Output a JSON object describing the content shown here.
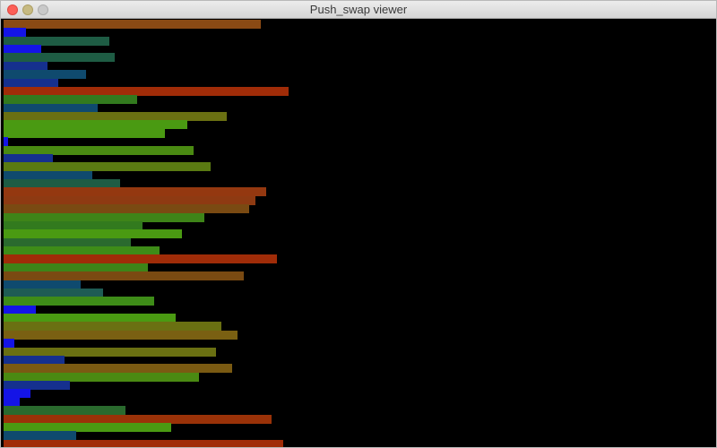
{
  "window": {
    "title": "Push_swap viewer"
  },
  "colors": {
    "background": "#000000",
    "blue": "#1414e6",
    "navy": "#15308e",
    "teal": "#0f4a6e",
    "dark-green": "#1e5c44",
    "green": "#327a1e",
    "lime": "#4a9a12",
    "olive": "#6a7012",
    "brown": "#7a4a12",
    "rust": "#8e3a12",
    "red": "#a02c08"
  },
  "stack": {
    "max_value": 330,
    "items": [
      {
        "value": 292,
        "color": "#8a4a14"
      },
      {
        "value": 25,
        "color": "#1414e6"
      },
      {
        "value": 120,
        "color": "#1e5c44"
      },
      {
        "value": 43,
        "color": "#1414e6"
      },
      {
        "value": 126,
        "color": "#1e5c44"
      },
      {
        "value": 50,
        "color": "#15308e"
      },
      {
        "value": 94,
        "color": "#0f4a6e"
      },
      {
        "value": 62,
        "color": "#15308e"
      },
      {
        "value": 324,
        "color": "#a02c08"
      },
      {
        "value": 152,
        "color": "#327a1e"
      },
      {
        "value": 107,
        "color": "#0f4a6e"
      },
      {
        "value": 254,
        "color": "#6a7012"
      },
      {
        "value": 209,
        "color": "#4a9a12"
      },
      {
        "value": 183,
        "color": "#4a9a12"
      },
      {
        "value": 5,
        "color": "#1414e6"
      },
      {
        "value": 216,
        "color": "#4a8a12"
      },
      {
        "value": 56,
        "color": "#15308e"
      },
      {
        "value": 235,
        "color": "#5a7a12"
      },
      {
        "value": 101,
        "color": "#0f4a6e"
      },
      {
        "value": 132,
        "color": "#1e5c44"
      },
      {
        "value": 298,
        "color": "#943810"
      },
      {
        "value": 286,
        "color": "#8e3a12"
      },
      {
        "value": 279,
        "color": "#7a4a12"
      },
      {
        "value": 228,
        "color": "#3e8418"
      },
      {
        "value": 158,
        "color": "#327a1e"
      },
      {
        "value": 203,
        "color": "#4a9a12"
      },
      {
        "value": 145,
        "color": "#2a6a2e"
      },
      {
        "value": 177,
        "color": "#3e8c18"
      },
      {
        "value": 311,
        "color": "#a02c08"
      },
      {
        "value": 164,
        "color": "#3e8418"
      },
      {
        "value": 273,
        "color": "#7a4a12"
      },
      {
        "value": 88,
        "color": "#0f4a6e"
      },
      {
        "value": 113,
        "color": "#1e5c54"
      },
      {
        "value": 171,
        "color": "#3e8c18"
      },
      {
        "value": 37,
        "color": "#1414e6"
      },
      {
        "value": 196,
        "color": "#4a9a12"
      },
      {
        "value": 247,
        "color": "#6a7012"
      },
      {
        "value": 266,
        "color": "#7a6012"
      },
      {
        "value": 12,
        "color": "#1414e6"
      },
      {
        "value": 241,
        "color": "#6a7012"
      },
      {
        "value": 69,
        "color": "#15308e"
      },
      {
        "value": 260,
        "color": "#7a5a12"
      },
      {
        "value": 222,
        "color": "#4a8a12"
      },
      {
        "value": 75,
        "color": "#15308e"
      },
      {
        "value": 31,
        "color": "#1414e6"
      },
      {
        "value": 18,
        "color": "#1414e6"
      },
      {
        "value": 139,
        "color": "#2a6a2e"
      },
      {
        "value": 305,
        "color": "#9a3208"
      },
      {
        "value": 190,
        "color": "#4a9a12"
      },
      {
        "value": 82,
        "color": "#0f4a6e"
      },
      {
        "value": 318,
        "color": "#a02c08"
      }
    ]
  }
}
